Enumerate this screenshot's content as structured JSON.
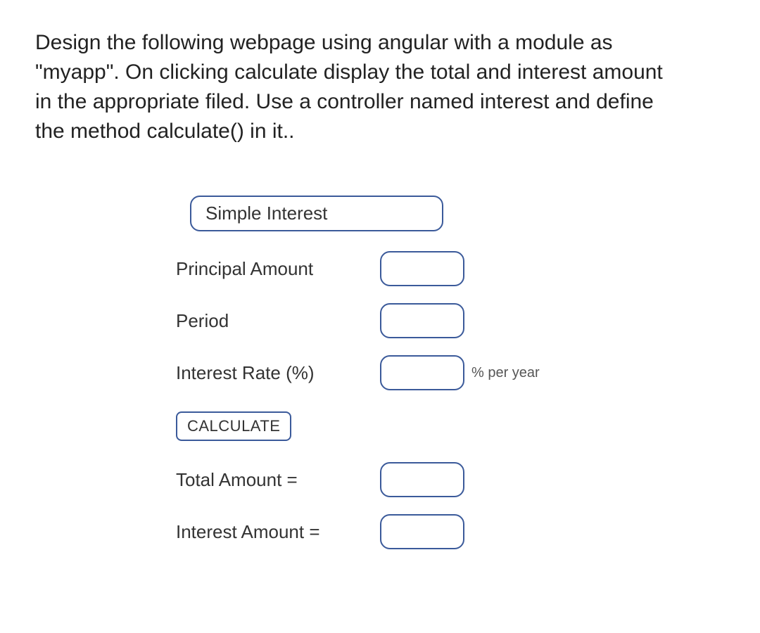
{
  "instructions": "Design the following webpage using angular with a module as \"myapp\". On clicking calculate display the total and interest amount in the appropriate filed. Use a controller named interest and define the method calculate() in it..",
  "form": {
    "title": "Simple Interest",
    "fields": {
      "principal": {
        "label": "Principal Amount",
        "value": ""
      },
      "period": {
        "label": "Period",
        "value": ""
      },
      "rate": {
        "label": "Interest Rate (%)",
        "value": "",
        "suffix": "% per year"
      }
    },
    "button": "CALCULATE",
    "results": {
      "total": {
        "label": "Total Amount  =",
        "value": ""
      },
      "interest": {
        "label": "Interest Amount  =",
        "value": ""
      }
    }
  }
}
